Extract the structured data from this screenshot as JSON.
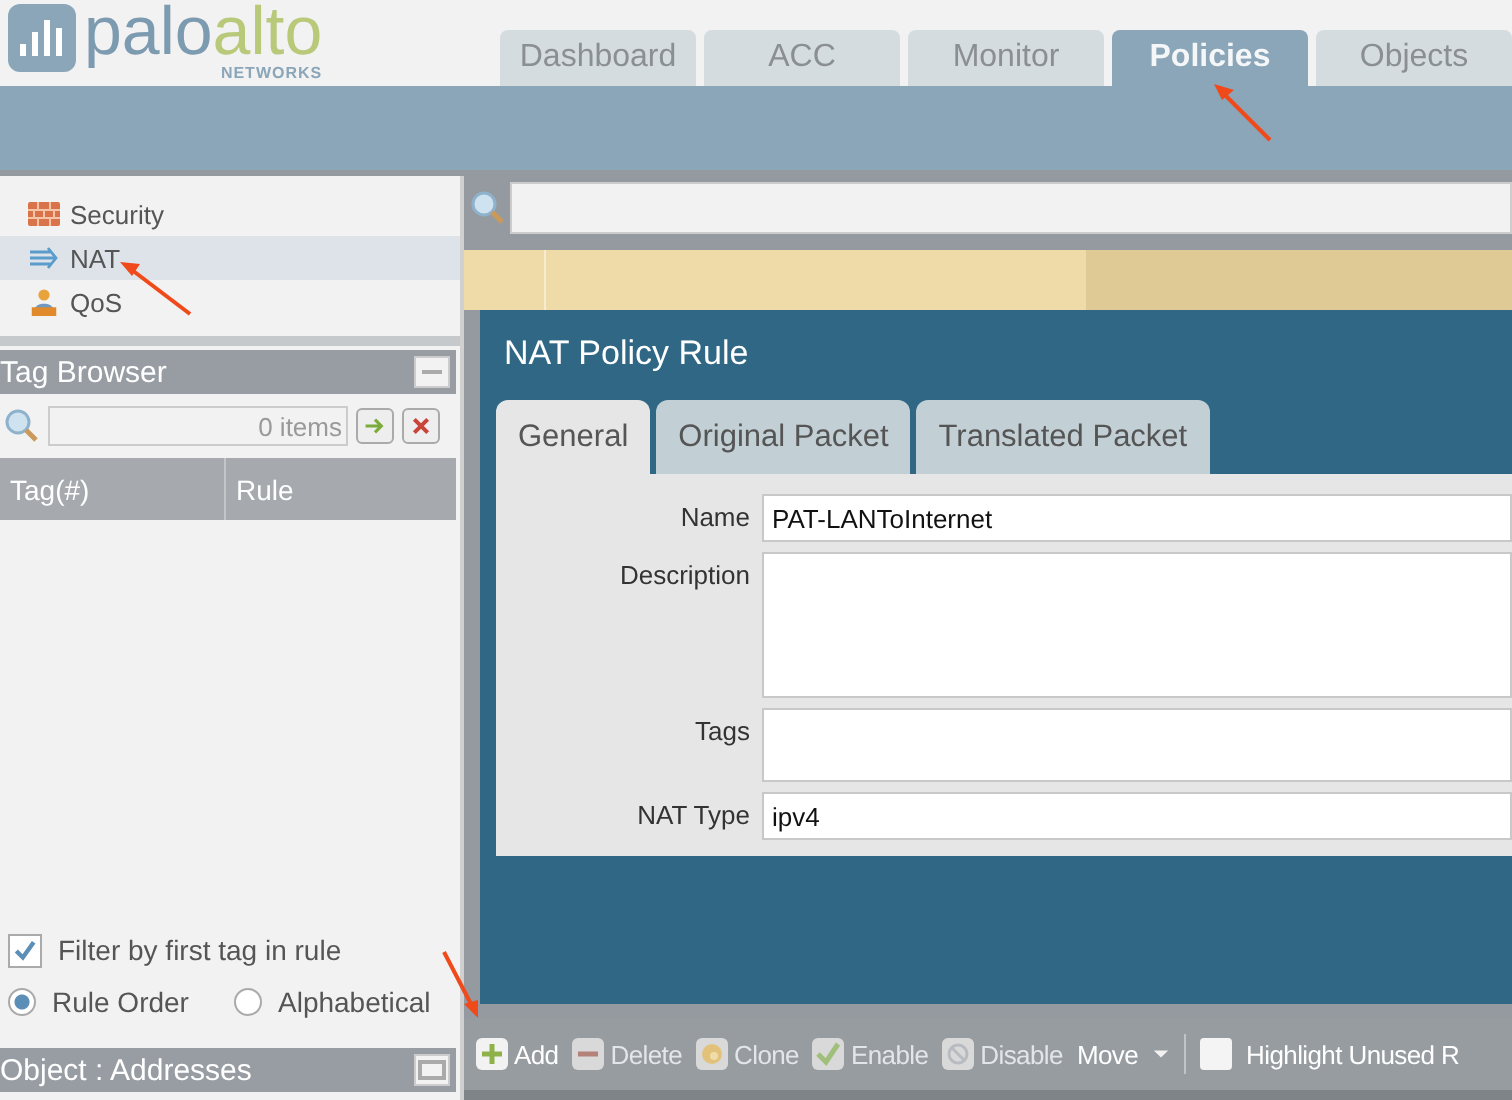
{
  "brand": {
    "primary": "palo",
    "secondary": "alto",
    "tagline": "NETWORKS"
  },
  "tabs": [
    {
      "label": "Dashboard",
      "selected": false
    },
    {
      "label": "ACC",
      "selected": false
    },
    {
      "label": "Monitor",
      "selected": false
    },
    {
      "label": "Policies",
      "selected": true
    },
    {
      "label": "Objects",
      "selected": false
    }
  ],
  "nav": [
    {
      "kind": "security",
      "label": "Security",
      "selected": false
    },
    {
      "kind": "nat",
      "label": "NAT",
      "selected": true
    },
    {
      "kind": "qos",
      "label": "QoS",
      "selected": false
    }
  ],
  "tag_browser": {
    "title": "Tag Browser",
    "search_placeholder": "0 items",
    "columns": [
      "Tag(#)",
      "Rule"
    ],
    "filter": {
      "label": "Filter by first tag in rule",
      "checked": true
    },
    "sort": [
      {
        "label": "Rule Order",
        "selected": true
      },
      {
        "label": "Alphabetical",
        "selected": false
      }
    ]
  },
  "object_panel": {
    "title": "Object : Addresses"
  },
  "dialog": {
    "title": "NAT Policy Rule",
    "tabs": [
      {
        "label": "General",
        "selected": true
      },
      {
        "label": "Original Packet",
        "selected": false
      },
      {
        "label": "Translated Packet",
        "selected": false
      }
    ],
    "fields": [
      {
        "kind": "text",
        "label": "Name",
        "value": "PAT-LANToInternet"
      },
      {
        "kind": "textarea",
        "label": "Description"
      },
      {
        "kind": "tags",
        "label": "Tags"
      },
      {
        "kind": "text",
        "label": "NAT Type",
        "value": "ipv4"
      }
    ]
  },
  "toolbar": [
    {
      "kind": "add",
      "label": "Add",
      "disabled": false
    },
    {
      "kind": "delete",
      "label": "Delete",
      "disabled": true
    },
    {
      "kind": "clone",
      "label": "Clone",
      "disabled": true
    },
    {
      "kind": "enable",
      "label": "Enable",
      "disabled": true
    },
    {
      "kind": "disable",
      "label": "Disable",
      "disabled": true
    },
    {
      "kind": "menu",
      "label": "Move",
      "disabled": false
    }
  ],
  "highlight_unused": {
    "label": "Highlight Unused R",
    "checked": false
  }
}
